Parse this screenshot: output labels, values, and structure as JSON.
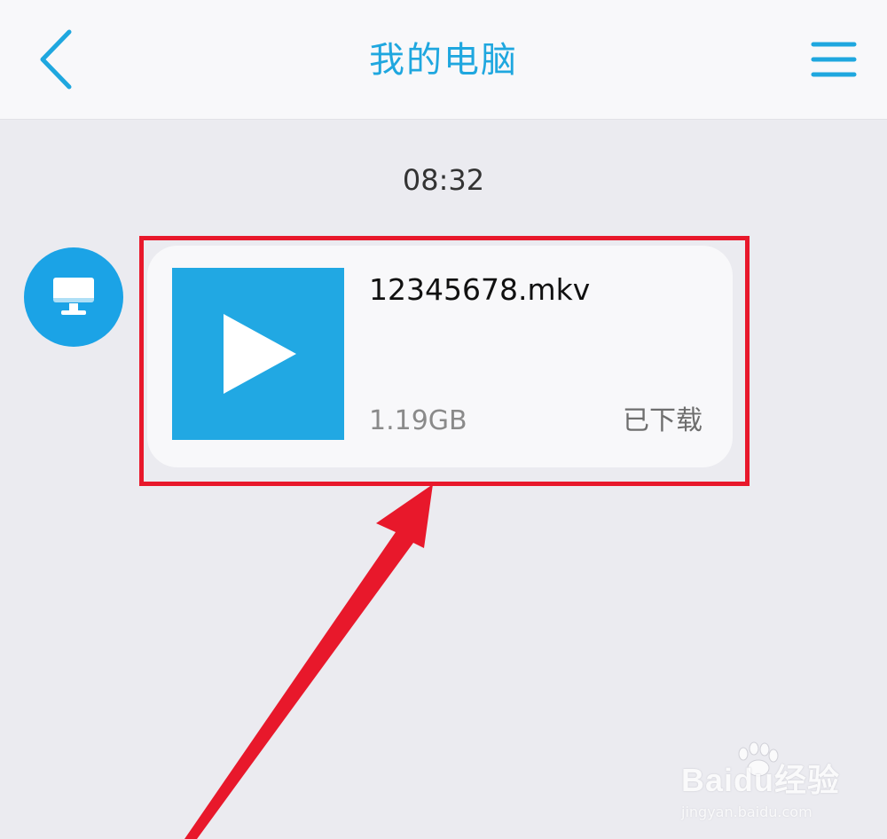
{
  "header": {
    "title": "我的电脑",
    "back_icon": "chevron-left-icon",
    "menu_icon": "menu-icon"
  },
  "chat": {
    "timestamp": "08:32",
    "sender_avatar_icon": "monitor-icon",
    "message": {
      "file_name": "12345678.mkv",
      "file_size": "1.19GB",
      "status": "已下载",
      "thumbnail_icon": "play-icon"
    }
  },
  "annotation": {
    "highlight_color": "#e8182b",
    "arrow_color": "#e8182b"
  },
  "watermark": {
    "text": "Baidu经验",
    "subtext": "jingyan.baidu.com"
  },
  "colors": {
    "accent": "#1fa7df",
    "background": "#ebebf0",
    "header_bg": "#f8f8fa",
    "card_bg": "#f8f8fa"
  }
}
